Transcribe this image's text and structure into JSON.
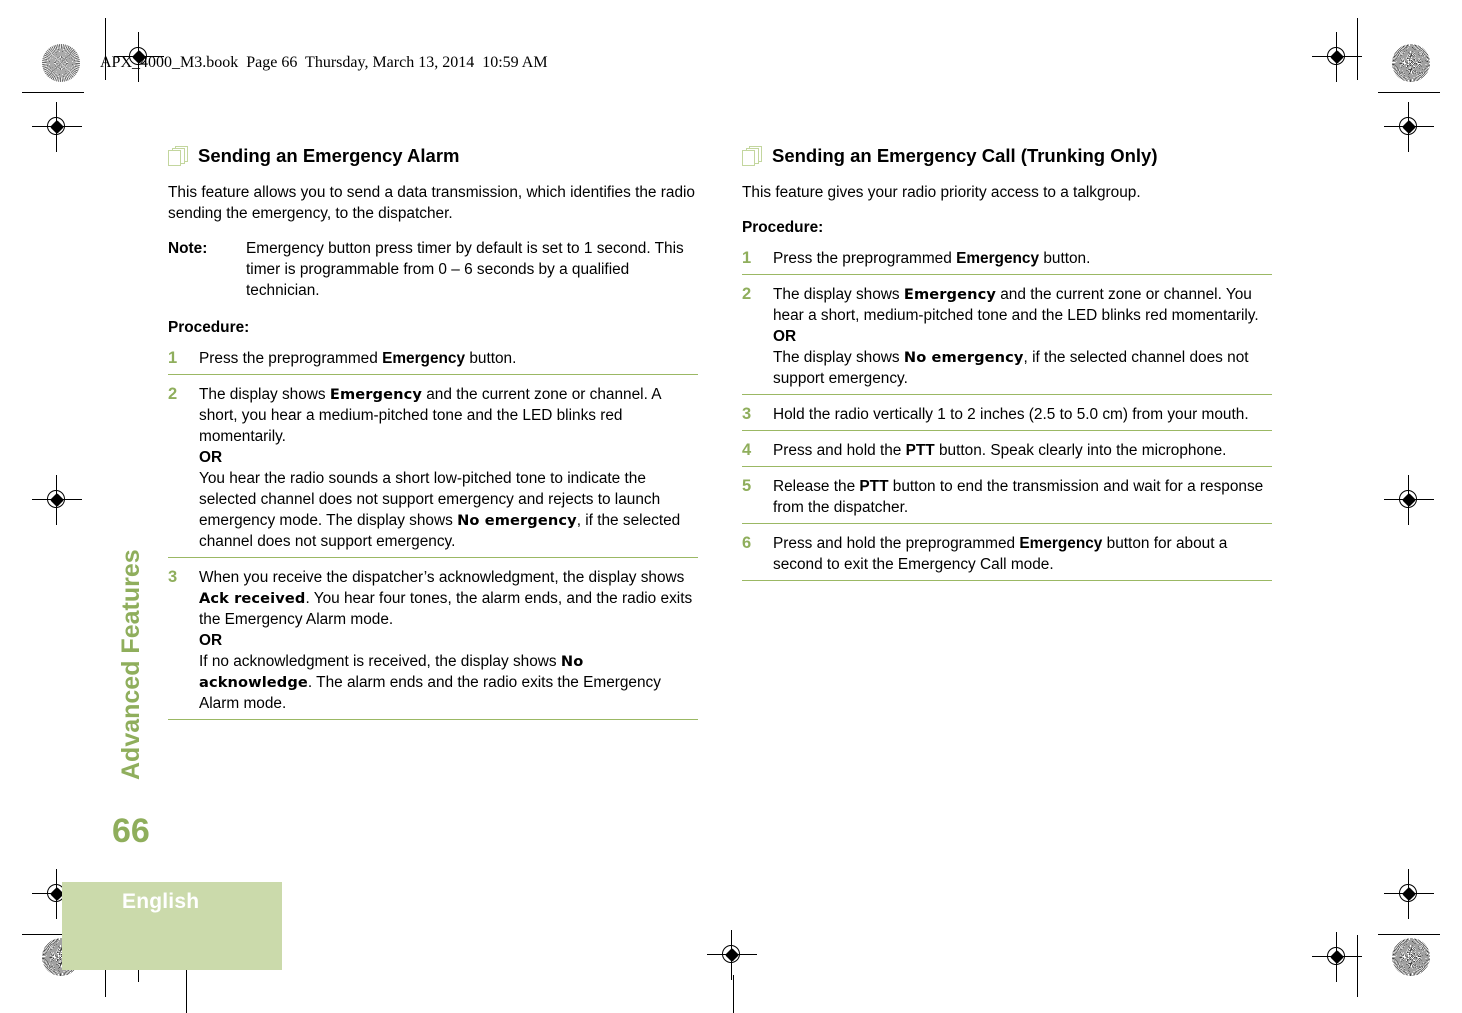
{
  "document": {
    "running_header": "APX_4000_M3.book  Page 66  Thursday, March 13, 2014  10:59 AM",
    "chapter_title": "Advanced Features",
    "page_number": "66",
    "language_tab": "English",
    "accent_green": "#8fae5c",
    "rule_green": "#9bb864",
    "tab_green": "#cbdaab",
    "icon_green": "#c3d69e"
  },
  "left_column": {
    "heading": "Sending an Emergency Alarm",
    "intro": "This feature allows you to send a data transmission, which identifies the radio sending the emergency, to the dispatcher.",
    "note_label": "Note:",
    "note_text": "Emergency button press timer by default is set to 1 second. This timer is programmable from 0 – 6 seconds by a qualified technician.",
    "procedure_label": "Procedure:",
    "steps": [
      {
        "num": "1",
        "parts": [
          {
            "t": "Press the preprogrammed ",
            "s": "plain"
          },
          {
            "t": "Emergency",
            "s": "bold"
          },
          {
            "t": " button.",
            "s": "plain"
          }
        ]
      },
      {
        "num": "2",
        "parts": [
          {
            "t": "The display shows ",
            "s": "plain"
          },
          {
            "t": "Emergency",
            "s": "lcd"
          },
          {
            "t": " and the current zone or channel. A short, you hear a medium-pitched tone and the LED blinks red momentarily.",
            "s": "plain"
          },
          {
            "t": "\n",
            "s": "break"
          },
          {
            "t": "OR",
            "s": "bold"
          },
          {
            "t": "\n",
            "s": "break"
          },
          {
            "t": "You hear the radio sounds a short low-pitched tone to indicate the selected channel does not support emergency and rejects to launch emergency mode. The display shows ",
            "s": "plain"
          },
          {
            "t": "No emergency",
            "s": "lcd"
          },
          {
            "t": ", if the selected channel does not support emergency.",
            "s": "plain"
          }
        ]
      },
      {
        "num": "3",
        "parts": [
          {
            "t": "When you receive the dispatcher’s acknowledgment, the display shows ",
            "s": "plain"
          },
          {
            "t": "Ack received",
            "s": "lcd"
          },
          {
            "t": ". You hear four tones, the alarm ends, and the radio exits the Emergency Alarm mode.",
            "s": "plain"
          },
          {
            "t": "\n",
            "s": "break"
          },
          {
            "t": "OR",
            "s": "bold"
          },
          {
            "t": "\n",
            "s": "break"
          },
          {
            "t": "If no acknowledgment is received, the display shows ",
            "s": "plain"
          },
          {
            "t": "No acknowledge",
            "s": "lcd"
          },
          {
            "t": ". The alarm ends and the radio exits the Emergency Alarm mode.",
            "s": "plain"
          }
        ]
      }
    ]
  },
  "right_column": {
    "heading": "Sending an Emergency Call (Trunking Only)",
    "intro": "This feature gives your radio priority access to a talkgroup.",
    "procedure_label": "Procedure:",
    "steps": [
      {
        "num": "1",
        "parts": [
          {
            "t": "Press the preprogrammed ",
            "s": "plain"
          },
          {
            "t": "Emergency",
            "s": "bold"
          },
          {
            "t": " button.",
            "s": "plain"
          }
        ]
      },
      {
        "num": "2",
        "parts": [
          {
            "t": "The display shows ",
            "s": "plain"
          },
          {
            "t": "Emergency",
            "s": "lcd"
          },
          {
            "t": " and the current zone or channel. You hear a short, medium-pitched tone and the LED blinks red momentarily.",
            "s": "plain"
          },
          {
            "t": "\n",
            "s": "break"
          },
          {
            "t": "OR",
            "s": "bold"
          },
          {
            "t": "\n",
            "s": "break"
          },
          {
            "t": "The display shows ",
            "s": "plain"
          },
          {
            "t": "No emergency",
            "s": "lcd"
          },
          {
            "t": ", if the selected channel does not support emergency.",
            "s": "plain"
          }
        ]
      },
      {
        "num": "3",
        "parts": [
          {
            "t": "Hold the radio vertically 1 to 2 inches (2.5 to 5.0 cm) from your mouth.",
            "s": "plain"
          }
        ]
      },
      {
        "num": "4",
        "parts": [
          {
            "t": "Press and hold the ",
            "s": "plain"
          },
          {
            "t": "PTT",
            "s": "bold"
          },
          {
            "t": " button. Speak clearly into the microphone.",
            "s": "plain"
          }
        ]
      },
      {
        "num": "5",
        "parts": [
          {
            "t": "Release the ",
            "s": "plain"
          },
          {
            "t": "PTT",
            "s": "bold"
          },
          {
            "t": " button to end the transmission and wait for a response from the dispatcher.",
            "s": "plain"
          }
        ]
      },
      {
        "num": "6",
        "parts": [
          {
            "t": "Press and hold the preprogrammed ",
            "s": "plain"
          },
          {
            "t": "Emergency",
            "s": "bold"
          },
          {
            "t": " button for about a second to exit the Emergency Call mode.",
            "s": "plain"
          }
        ]
      }
    ]
  }
}
